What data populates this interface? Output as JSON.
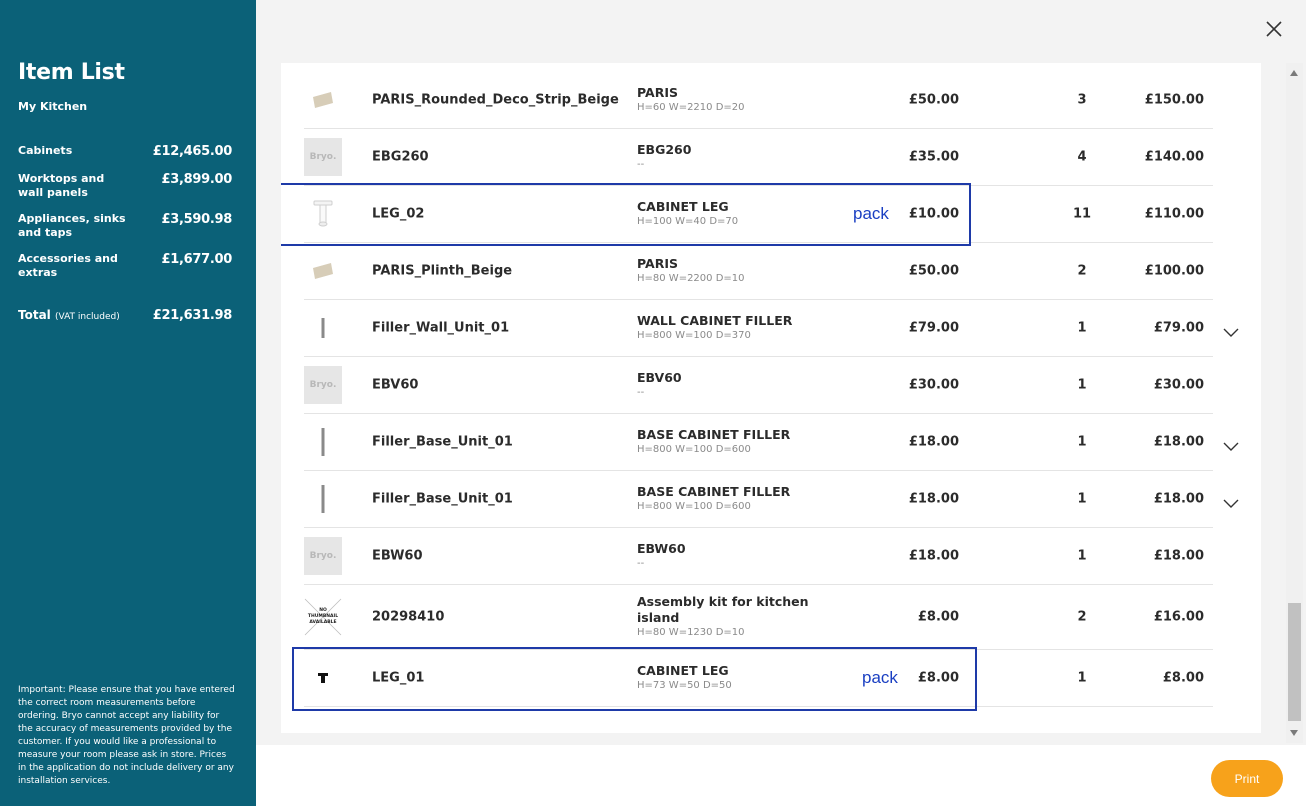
{
  "sidebar": {
    "title": "Item List",
    "subtitle": "My Kitchen",
    "summary": [
      {
        "label": "Cabinets",
        "value": "£12,465.00"
      },
      {
        "label": "Worktops and wall panels",
        "value": "£3,899.00"
      },
      {
        "label": "Appliances, sinks and taps",
        "value": "£3,590.98"
      },
      {
        "label": "Accessories and extras",
        "value": "£1,677.00"
      }
    ],
    "total_label": "Total",
    "total_vat": "(VAT included)",
    "total_value": "£21,631.98",
    "note": "Important: Please ensure that you have entered the correct room measurements before ordering. Bryo cannot accept any liability for the accuracy of measurements provided by the customer. If you would like a professional to measure your room please ask in store. Prices in the application do not include delivery or any installation services."
  },
  "items": [
    {
      "name": "PARIS_Rounded_Deco_Strip_Beige",
      "title": "PARIS",
      "dims": "H=60 W=2210 D=20",
      "price": "£50.00",
      "qty": "3",
      "total": "£150.00",
      "thumb": "beige-strip-icon"
    },
    {
      "name": "EBG260",
      "title": "EBG260",
      "dims": "--",
      "price": "£35.00",
      "qty": "4",
      "total": "£140.00",
      "thumb": "bryo-placeholder",
      "thumb_text": "Bryo."
    },
    {
      "name": "LEG_02",
      "title": "CABINET LEG",
      "dims": "H=100 W=40 D=70",
      "price": "£10.00",
      "qty": "11",
      "total": "£110.00",
      "thumb": "cabinet-leg-icon",
      "annotation": "pack"
    },
    {
      "name": "PARIS_Plinth_Beige",
      "title": "PARIS",
      "dims": "H=80 W=2200 D=10",
      "price": "£50.00",
      "qty": "2",
      "total": "£100.00",
      "thumb": "beige-strip-icon"
    },
    {
      "name": "Filler_Wall_Unit_01",
      "title": "WALL CABINET FILLER",
      "dims": "H=800 W=100 D=370",
      "price": "£79.00",
      "qty": "1",
      "total": "£79.00",
      "thumb": "filler-icon",
      "expand": true
    },
    {
      "name": "EBV60",
      "title": "EBV60",
      "dims": "--",
      "price": "£30.00",
      "qty": "1",
      "total": "£30.00",
      "thumb": "bryo-placeholder",
      "thumb_text": "Bryo."
    },
    {
      "name": "Filler_Base_Unit_01",
      "title": "BASE CABINET FILLER",
      "dims": "H=800 W=100 D=600",
      "price": "£18.00",
      "qty": "1",
      "total": "£18.00",
      "thumb": "filler-icon",
      "expand": true
    },
    {
      "name": "Filler_Base_Unit_01",
      "title": "BASE CABINET FILLER",
      "dims": "H=800 W=100 D=600",
      "price": "£18.00",
      "qty": "1",
      "total": "£18.00",
      "thumb": "filler-icon",
      "expand": true
    },
    {
      "name": "EBW60",
      "title": "EBW60",
      "dims": "--",
      "price": "£18.00",
      "qty": "1",
      "total": "£18.00",
      "thumb": "bryo-placeholder",
      "thumb_text": "Bryo."
    },
    {
      "name": "20298410",
      "title": "Assembly kit for kitchen island",
      "dims": "H=80 W=1230 D=10",
      "price": "£8.00",
      "qty": "2",
      "total": "£16.00",
      "thumb": "no-thumbnail-icon",
      "thumb_text": "NO THUMBNAIL AVAILABLE"
    },
    {
      "name": "LEG_01",
      "title": "CABINET LEG",
      "dims": "H=73 W=50 D=50",
      "price": "£8.00",
      "qty": "1",
      "total": "£8.00",
      "thumb": "small-leg-icon",
      "annotation": "pack"
    }
  ],
  "footer": {
    "print_label": "Print"
  },
  "colors": {
    "sidebar": "#0b6178",
    "accent": "#f7a21b",
    "annotation": "#1a3fc2"
  }
}
